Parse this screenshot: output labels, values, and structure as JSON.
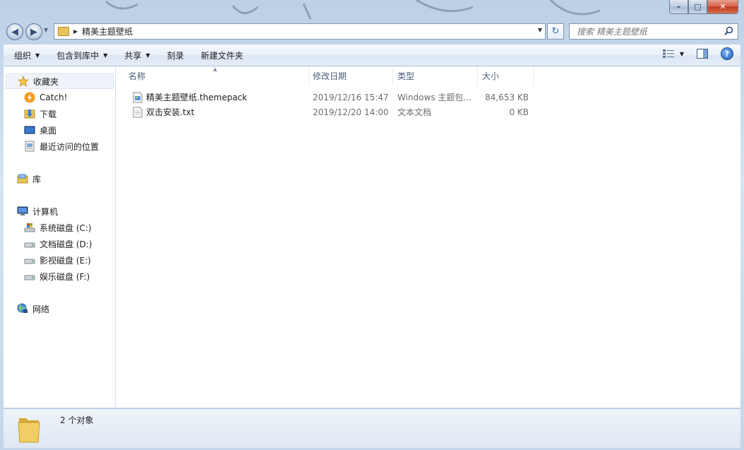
{
  "window": {
    "minimize": "–",
    "maximize": "□",
    "close": "✕"
  },
  "address": {
    "folder_name": "精美主题壁纸"
  },
  "search": {
    "placeholder": "搜索 精美主题壁纸"
  },
  "toolbar": {
    "organize": "组织",
    "include_in_library": "包含到库中",
    "share": "共享",
    "burn": "刻录",
    "new_folder": "新建文件夹",
    "help": "?"
  },
  "sidebar": {
    "favorites": "收藏夹",
    "favorites_items": [
      "Catch!",
      "下载",
      "桌面",
      "最近访问的位置"
    ],
    "libraries": "库",
    "computer": "计算机",
    "drives": [
      "系统磁盘 (C:)",
      "文档磁盘 (D:)",
      "影视磁盘 (E:)",
      "娱乐磁盘 (F:)"
    ],
    "network": "网络"
  },
  "columns": {
    "name": "名称",
    "modified": "修改日期",
    "type": "类型",
    "size": "大小"
  },
  "files": [
    {
      "name": "精美主题壁纸.themepack",
      "modified": "2019/12/16 15:47",
      "type": "Windows 主题包...",
      "size": "84,653 KB",
      "icon": "themepack-file-icon"
    },
    {
      "name": "双击安装.txt",
      "modified": "2019/12/20 14:00",
      "type": "文本文档",
      "size": "0 KB",
      "icon": "text-file-icon"
    }
  ],
  "status": {
    "count_text": "2 个对象"
  }
}
